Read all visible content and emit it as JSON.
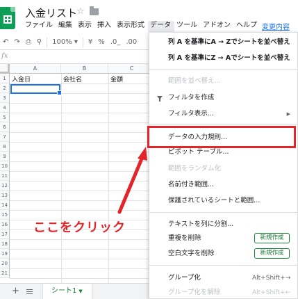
{
  "header": {
    "doc_title": "入金リスト",
    "star_icon": "star-icon",
    "folder_icon": "folder-icon",
    "recent_change": "変更内容"
  },
  "menubar": [
    {
      "label": "ファイル",
      "active": false
    },
    {
      "label": "編集",
      "active": false
    },
    {
      "label": "表示",
      "active": false
    },
    {
      "label": "挿入",
      "active": false
    },
    {
      "label": "表示形式",
      "active": false
    },
    {
      "label": "データ",
      "active": true
    },
    {
      "label": "ツール",
      "active": false
    },
    {
      "label": "アドオン",
      "active": false
    },
    {
      "label": "ヘルプ",
      "active": false
    }
  ],
  "toolbar": {
    "zoom": "100%",
    "currency": "¥",
    "percent": "%",
    "dec_less": ".0_",
    "dec_more": ".00"
  },
  "sheet": {
    "columns": [
      "A",
      "B",
      "C"
    ],
    "rows": [
      "1",
      "2",
      "3",
      "4",
      "5",
      "6",
      "7",
      "8",
      "9",
      "10",
      "11",
      "12",
      "13",
      "14",
      "15",
      "16",
      "17",
      "18",
      "19",
      "20",
      "21"
    ],
    "header_cells": [
      "入金日",
      "会社名",
      "金額"
    ]
  },
  "sheet_tabs": {
    "active_tab": "シート1"
  },
  "data_menu": {
    "sort_a_to_z": "列 A を基準にA → Zでシートを並べ替え",
    "sort_z_to_a": "列 A を基準にZ → Aでシートを並べ替え",
    "sort_range": "範囲を並べ替え...",
    "create_filter": "フィルタを作成",
    "filter_views": "フィルタ表示...",
    "data_validation": "データの入力規則...",
    "pivot_table": "ピボット テーブル...",
    "randomize_range": "範囲をランダム化",
    "named_ranges": "名前付き範囲...",
    "protected_sheets": "保護されているシートと範囲...",
    "split_text": "テキストを列に分割...",
    "remove_duplicates": "重複を削除",
    "trim_whitespace": "空白文字を削除",
    "new_badge": "新規作成",
    "group": "グループ化",
    "group_shortcut": "Alt+Shift+→",
    "ungroup": "グループ化を解除",
    "ungroup_shortcut": "Alt+Shift+←"
  },
  "annotation": {
    "callout_text": "ここをクリック",
    "color": "#e3242b"
  },
  "colors": {
    "brand_green": "#0f9d58",
    "accent_blue": "#1a73e8",
    "new_badge_green": "#188038"
  }
}
